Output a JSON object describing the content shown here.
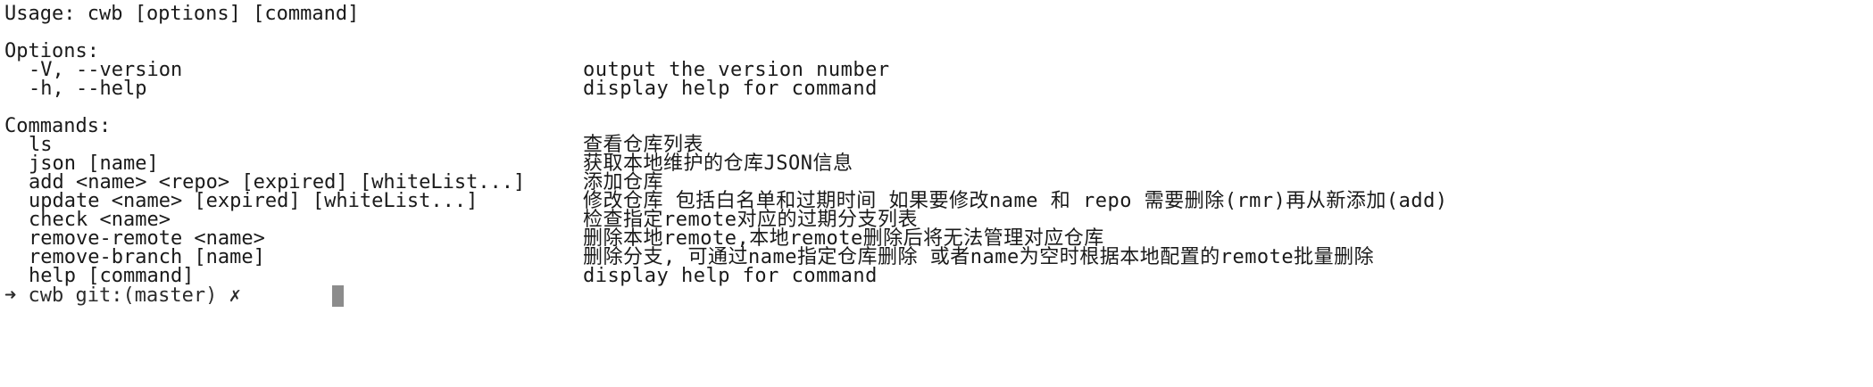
{
  "usage": "Usage: cwb [options] [command]",
  "options": {
    "heading": "Options:",
    "items": [
      {
        "flag": "-V, --version",
        "desc": "output the version number"
      },
      {
        "flag": "-h, --help",
        "desc": "display help for command"
      }
    ]
  },
  "commands": {
    "heading": "Commands:",
    "items": [
      {
        "cmd": "ls",
        "desc": "查看仓库列表"
      },
      {
        "cmd": "json [name]",
        "desc": "获取本地维护的仓库JSON信息"
      },
      {
        "cmd": "add <name> <repo> [expired] [whiteList...]",
        "desc": "添加仓库"
      },
      {
        "cmd": "update <name> [expired] [whiteList...]",
        "desc": "修改仓库 包括白名单和过期时间 如果要修改name 和 repo 需要删除(rmr)再从新添加(add)"
      },
      {
        "cmd": "check <name>",
        "desc": "检查指定remote对应的过期分支列表"
      },
      {
        "cmd": "remove-remote <name>",
        "desc": "删除本地remote,本地remote删除后将无法管理对应仓库"
      },
      {
        "cmd": "remove-branch [name]",
        "desc": "删除分支, 可通过name指定仓库删除 或者name为空时根据本地配置的remote批量删除"
      },
      {
        "cmd": "help [command]",
        "desc": "display help for command"
      }
    ]
  },
  "prompt_partial": "➜ cwb git:(master) ✗"
}
